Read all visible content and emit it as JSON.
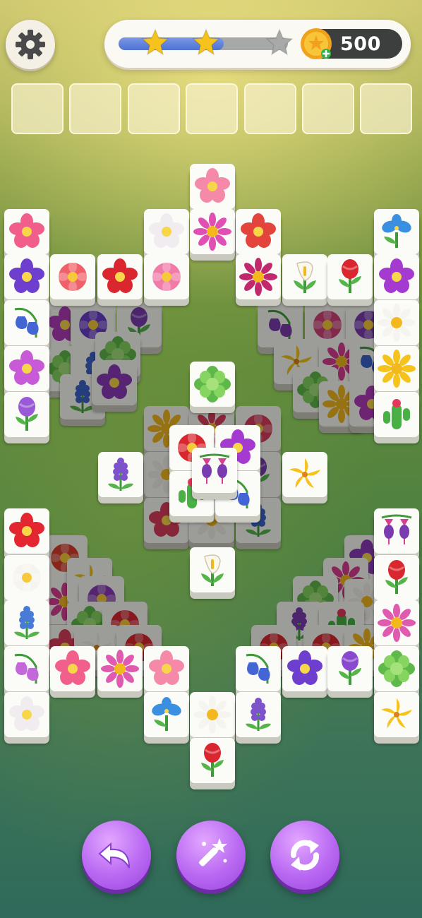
{
  "header": {
    "coins": "500",
    "star_progress": 0.62,
    "stars_earned": 2,
    "stars_total": 3
  },
  "slots": {
    "count": 7,
    "filled": 0
  },
  "icons": {
    "settings": "gear-icon",
    "coin": "coin-icon",
    "undo": "undo-arrow-icon",
    "hint": "magic-wand-icon",
    "shuffle": "shuffle-icon"
  },
  "colors": {
    "progress_fill": "#4f73d1",
    "star": "#f6c21c",
    "tool_button": "#b968f2",
    "coin_box": "#3d3f3f"
  },
  "tiles": [
    {
      "flower": "cherry-blossom"
    },
    {
      "flower": "lotus"
    },
    {
      "flower": "anemone"
    },
    {
      "flower": "pink-daisy"
    },
    {
      "flower": "begonia"
    },
    {
      "flower": "blue-iris"
    },
    {
      "flower": "pansy"
    },
    {
      "flower": "zinnia"
    },
    {
      "flower": "poppy"
    },
    {
      "flower": "peony"
    },
    {
      "flower": "dahlia"
    },
    {
      "flower": "calla-lily"
    },
    {
      "flower": "carnation"
    },
    {
      "flower": "orchid"
    },
    {
      "flower": "bluebell"
    },
    {
      "flower": "white-daisy"
    },
    {
      "flower": "orchid"
    },
    {
      "flower": "sunflower"
    },
    {
      "flower": "tulip"
    },
    {
      "flower": "cactus"
    },
    {
      "flower": "succulent"
    },
    {
      "flower": "lavender"
    },
    {
      "flower": "lily"
    },
    {
      "flower": "fuchsia"
    },
    {
      "flower": "hibiscus"
    },
    {
      "flower": "fuchsia"
    },
    {
      "flower": "gardenia"
    },
    {
      "flower": "rose"
    },
    {
      "flower": "delphinium"
    },
    {
      "flower": "pink-daisy"
    },
    {
      "flower": "sweet-pea"
    },
    {
      "flower": "lotus"
    },
    {
      "flower": "pink-daisy"
    },
    {
      "flower": "cherry-blossom"
    },
    {
      "flower": "bluebell"
    },
    {
      "flower": "pansy"
    },
    {
      "flower": "tulip"
    },
    {
      "flower": "succulent"
    },
    {
      "flower": "anemone"
    },
    {
      "flower": "blue-iris"
    },
    {
      "flower": "white-daisy"
    },
    {
      "flower": "lavender"
    },
    {
      "flower": "lily"
    },
    {
      "flower": "carnation"
    },
    {
      "flower": "calla-lily"
    }
  ]
}
